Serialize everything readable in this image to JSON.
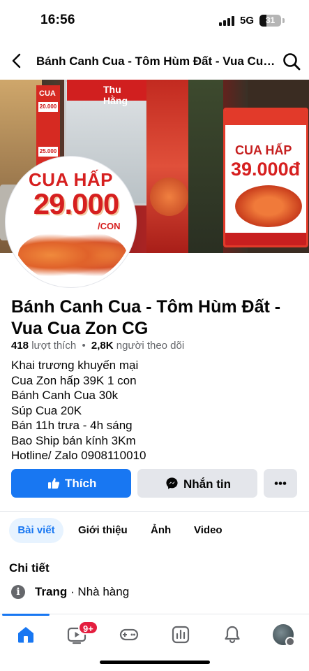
{
  "status_bar": {
    "time": "16:56",
    "network": "5G",
    "battery": "31",
    "battery_level_percent": 31
  },
  "header": {
    "title": "Bánh Canh Cua - Tôm Hùm Đất - Vua Cua Zon CG"
  },
  "cover": {
    "sign_left_title": "CUA",
    "sign_left_price_1": "20.000",
    "sign_left_price_2": "25.000",
    "banner_text": "Thu Hằng",
    "poster_title": "CUA HẤP",
    "poster_price": "39.000đ"
  },
  "avatar_image": {
    "line1": "CUA HẤP",
    "line2": "29.000",
    "line3": "/CON"
  },
  "page": {
    "name": "Bánh Canh Cua - Tôm Hùm Đất - Vua Cua Zon CG",
    "likes_count": "418",
    "likes_label": "lượt thích",
    "separator": "•",
    "followers_count": "2,8K",
    "followers_label": "người theo dõi",
    "bio": [
      "Khai trương khuyến mại",
      "Cua Zon hấp 39K 1 con",
      "Bánh Canh Cua 30k",
      "Súp Cua 20K",
      "Bán 11h trưa - 4h sáng",
      "Bao Ship bán kính 3Km",
      "Hotline/ Zalo 0908110010"
    ]
  },
  "actions": {
    "like_label": "Thích",
    "message_label": "Nhắn tin",
    "more_label": "•••"
  },
  "tabs": [
    {
      "label": "Bài viết",
      "active": true
    },
    {
      "label": "Giới thiệu",
      "active": false
    },
    {
      "label": "Ảnh",
      "active": false
    },
    {
      "label": "Video",
      "active": false
    }
  ],
  "details": {
    "section_title": "Chi tiết",
    "category_label": "Trang",
    "category_value": "· Nhà hàng"
  },
  "bottom_nav": {
    "items": [
      "home-icon",
      "video-icon",
      "gaming-icon",
      "dashboard-icon",
      "bell-icon",
      "profile-avatar"
    ],
    "video_badge": "9+"
  },
  "colors": {
    "accent": "#1877f2",
    "secondary_button": "#e4e6eb",
    "text_secondary": "#65676b",
    "badge": "#e41e3f"
  }
}
